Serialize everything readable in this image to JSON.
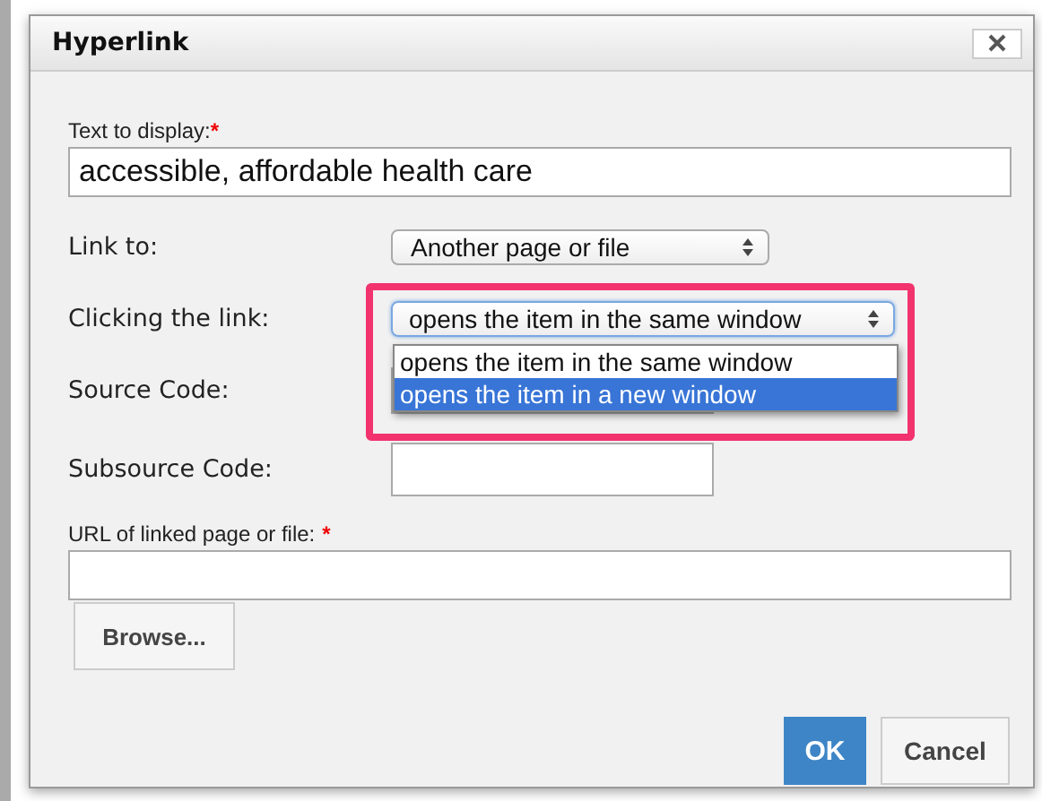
{
  "dialog": {
    "title": "Hyperlink"
  },
  "text_to_display": {
    "label": "Text to display:",
    "required_mark": "*",
    "value": "accessible, affordable health care"
  },
  "link_to": {
    "label": "Link to:",
    "value": "Another page or file"
  },
  "clicking_the_link": {
    "label": "Clicking the link:",
    "value": "opens the item in the same window",
    "expanded": true,
    "highlighted": true,
    "options": [
      {
        "label": "opens the item in the same window",
        "highlighted": false
      },
      {
        "label": "opens the item in a new window",
        "highlighted": true
      }
    ]
  },
  "source_code": {
    "label": "Source Code:"
  },
  "subsource_code": {
    "label": "Subsource Code:"
  },
  "url": {
    "label": "URL of linked page or file:",
    "required_mark": "*"
  },
  "buttons": {
    "browse": "Browse...",
    "ok": "OK",
    "cancel": "Cancel"
  }
}
